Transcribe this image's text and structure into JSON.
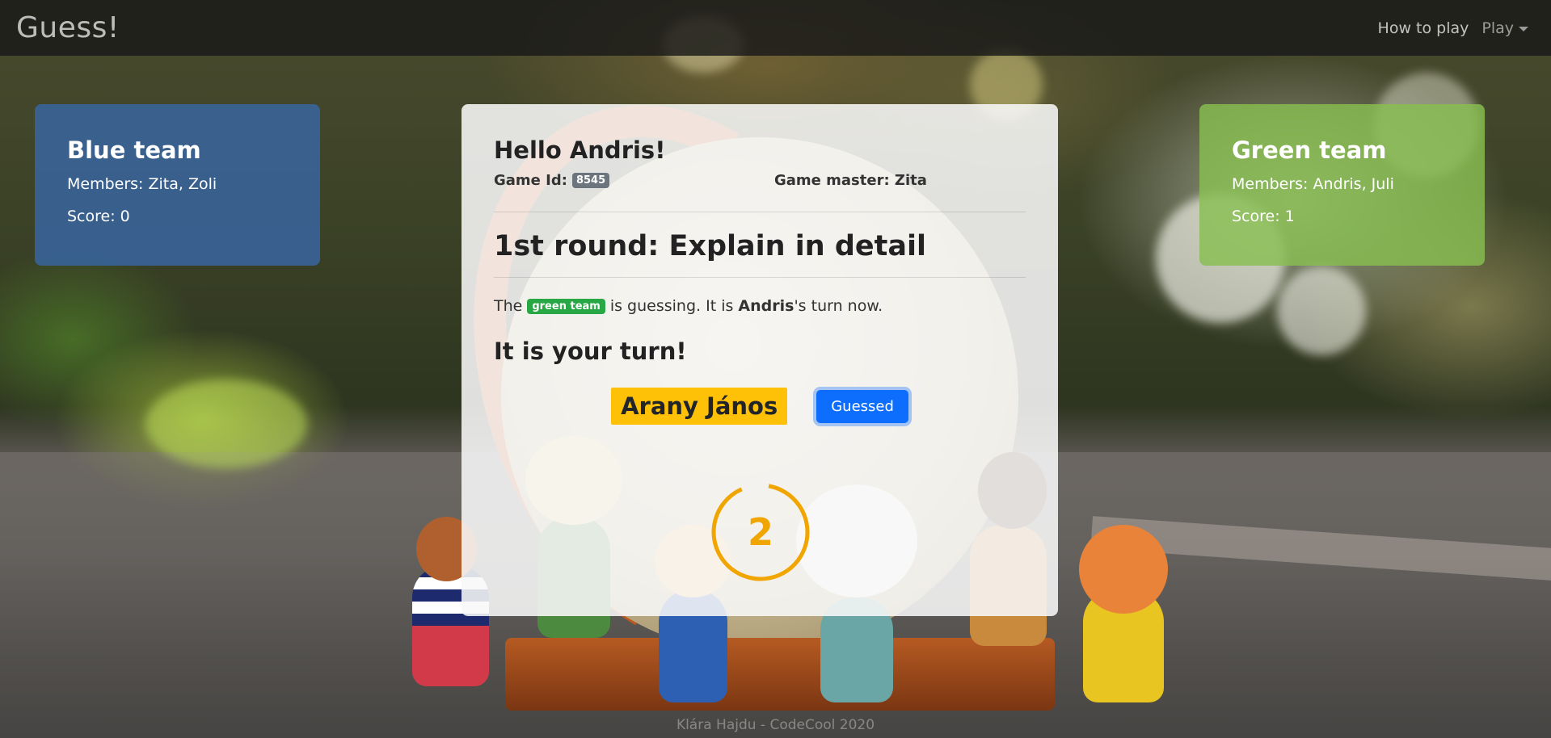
{
  "navbar": {
    "brand": "Guess!",
    "how_to_play": "How to play",
    "play": "Play"
  },
  "teams": {
    "blue": {
      "title": "Blue team",
      "members": "Members: Zita, Zoli",
      "score": "Score: 0"
    },
    "green": {
      "title": "Green team",
      "members": "Members: Andris, Juli",
      "score": "Score: 1"
    }
  },
  "game": {
    "greeting": "Hello Andris!",
    "game_id_label": "Game Id:",
    "game_id": "8545",
    "game_master": "Game master: Zita",
    "round_title": "1st round: Explain in detail",
    "guessing_prefix": "The",
    "guessing_team": "green team",
    "guessing_middle": "is guessing. It is",
    "guessing_player": "Andris",
    "guessing_suffix": "'s turn now.",
    "your_turn": "It is your turn!",
    "word": "Arany János",
    "guessed_button": "Guessed",
    "timer": "2"
  },
  "footer": "Klára Hajdu - CodeCool 2020",
  "colors": {
    "blue_team": "#3868aa",
    "green_team": "#88be50",
    "word_bg": "#ffc107",
    "button": "#0d6efd",
    "timer": "#f0a500",
    "badge_team": "#28a745"
  }
}
